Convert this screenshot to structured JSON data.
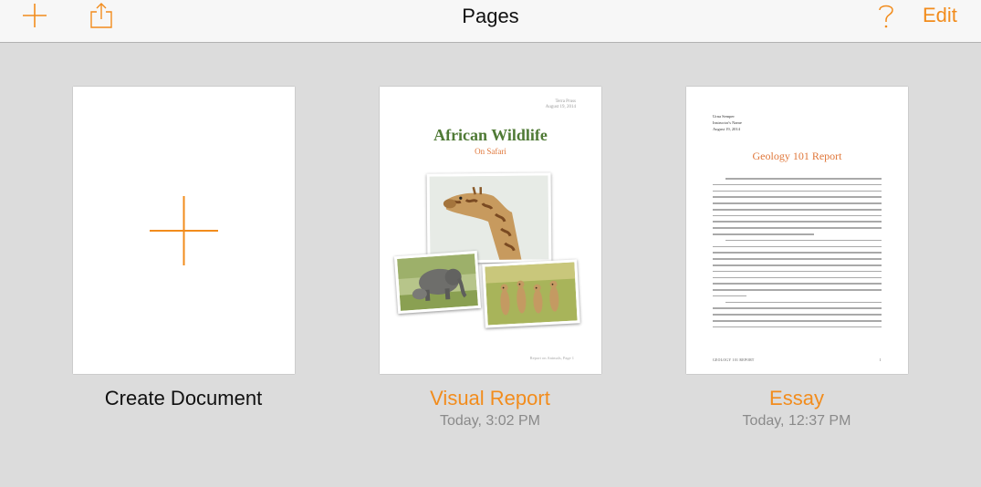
{
  "toolbar": {
    "title": "Pages",
    "add_icon": "plus-icon",
    "share_icon": "share-icon",
    "help_icon": "question-mark-icon",
    "edit_label": "Edit",
    "accent_color": "#f28c1c"
  },
  "documents": [
    {
      "name": "Create Document",
      "date": "",
      "icon": "plus-icon"
    },
    {
      "name": "Visual Report",
      "date": "Today, 3:02 PM",
      "thumbnail": {
        "meta_name": "Terra Pruss",
        "meta_date": "August 19, 2014",
        "title": "African Wildlife",
        "subtitle": "On Safari",
        "footer": "Report on Animals, Page 1",
        "photos": [
          "giraffe",
          "elephants",
          "meerkats"
        ]
      }
    },
    {
      "name": "Essay",
      "date": "Today, 12:37 PM",
      "thumbnail": {
        "author": "Urna Semper",
        "instructor": "Instructor's Name",
        "date": "August 19, 2014",
        "title": "Geology 101 Report",
        "footer_label": "Geology 101 Report",
        "page_number": "1"
      }
    }
  ]
}
